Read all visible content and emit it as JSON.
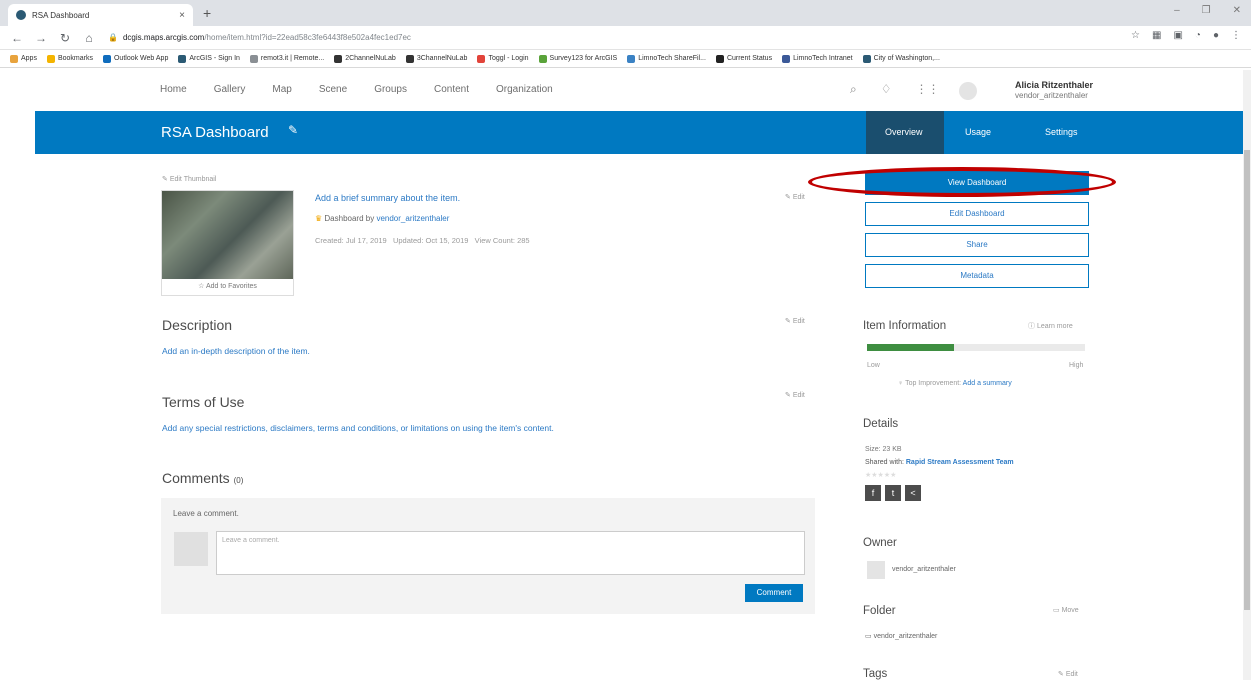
{
  "browser": {
    "tab_title": "RSA Dashboard",
    "url_host": "dcgis.maps.arcgis.com",
    "url_path": "/home/item.html?id=22ead58c3fe6443f8e502a4fec1ed7ec",
    "bookmarks": [
      "Apps",
      "Bookmarks",
      "Outlook Web App",
      "ArcGIS - Sign In",
      "remot3.it | Remote...",
      "2ChannelNuLab",
      "3ChannelNuLab",
      "Toggl - Login",
      "Survey123 for ArcGIS",
      "LimnoTech ShareFil...",
      "Current Status",
      "LimnoTech Intranet",
      "City of Washington,..."
    ]
  },
  "topnav": {
    "links": [
      "Home",
      "Gallery",
      "Map",
      "Scene",
      "Groups",
      "Content",
      "Organization"
    ],
    "user_name": "Alicia Ritzenthaler",
    "user_id": "vendor_aritzenthaler"
  },
  "header": {
    "title": "RSA Dashboard",
    "tabs": [
      "Overview",
      "Usage",
      "Settings"
    ]
  },
  "item": {
    "edit_thumbnail": "Edit Thumbnail",
    "add_to_favorites": "Add to Favorites",
    "summary": "Add a brief summary about the item.",
    "type_owner_prefix": "Dashboard by",
    "owner": "vendor_aritzenthaler",
    "meta": "Created: Jul 17, 2019   Updated: Oct 15, 2019   View Count: 285",
    "edit": "Edit"
  },
  "description": {
    "heading": "Description",
    "text": "Add an in-depth description of the item."
  },
  "terms": {
    "heading": "Terms of Use",
    "text": "Add any special restrictions, disclaimers, terms and conditions, or limitations on using the item's content."
  },
  "comments": {
    "heading": "Comments",
    "count": "(0)",
    "label": "Leave a comment.",
    "placeholder": "Leave a comment.",
    "button": "Comment"
  },
  "actions": [
    "View Dashboard",
    "Edit Dashboard",
    "Share",
    "Metadata"
  ],
  "item_info": {
    "heading": "Item Information",
    "learn_more": "Learn more",
    "low": "Low",
    "high": "High",
    "progress": 0.4,
    "top_improvement_label": "Top Improvement:",
    "top_improvement_link": "Add a summary"
  },
  "details": {
    "heading": "Details",
    "size": "Size: 23 KB",
    "shared_prefix": "Shared with:",
    "shared_group": "Rapid Stream Assessment Team",
    "stars": "★★★★★"
  },
  "owner": {
    "heading": "Owner",
    "name": "vendor_aritzenthaler"
  },
  "folder": {
    "heading": "Folder",
    "move": "Move",
    "name": "vendor_aritzenthaler"
  },
  "tags": {
    "heading": "Tags",
    "edit": "Edit"
  },
  "colors": {
    "brand_blue": "#0079c1",
    "highlight_red": "#c00000",
    "progress_green": "#3e8e41"
  }
}
